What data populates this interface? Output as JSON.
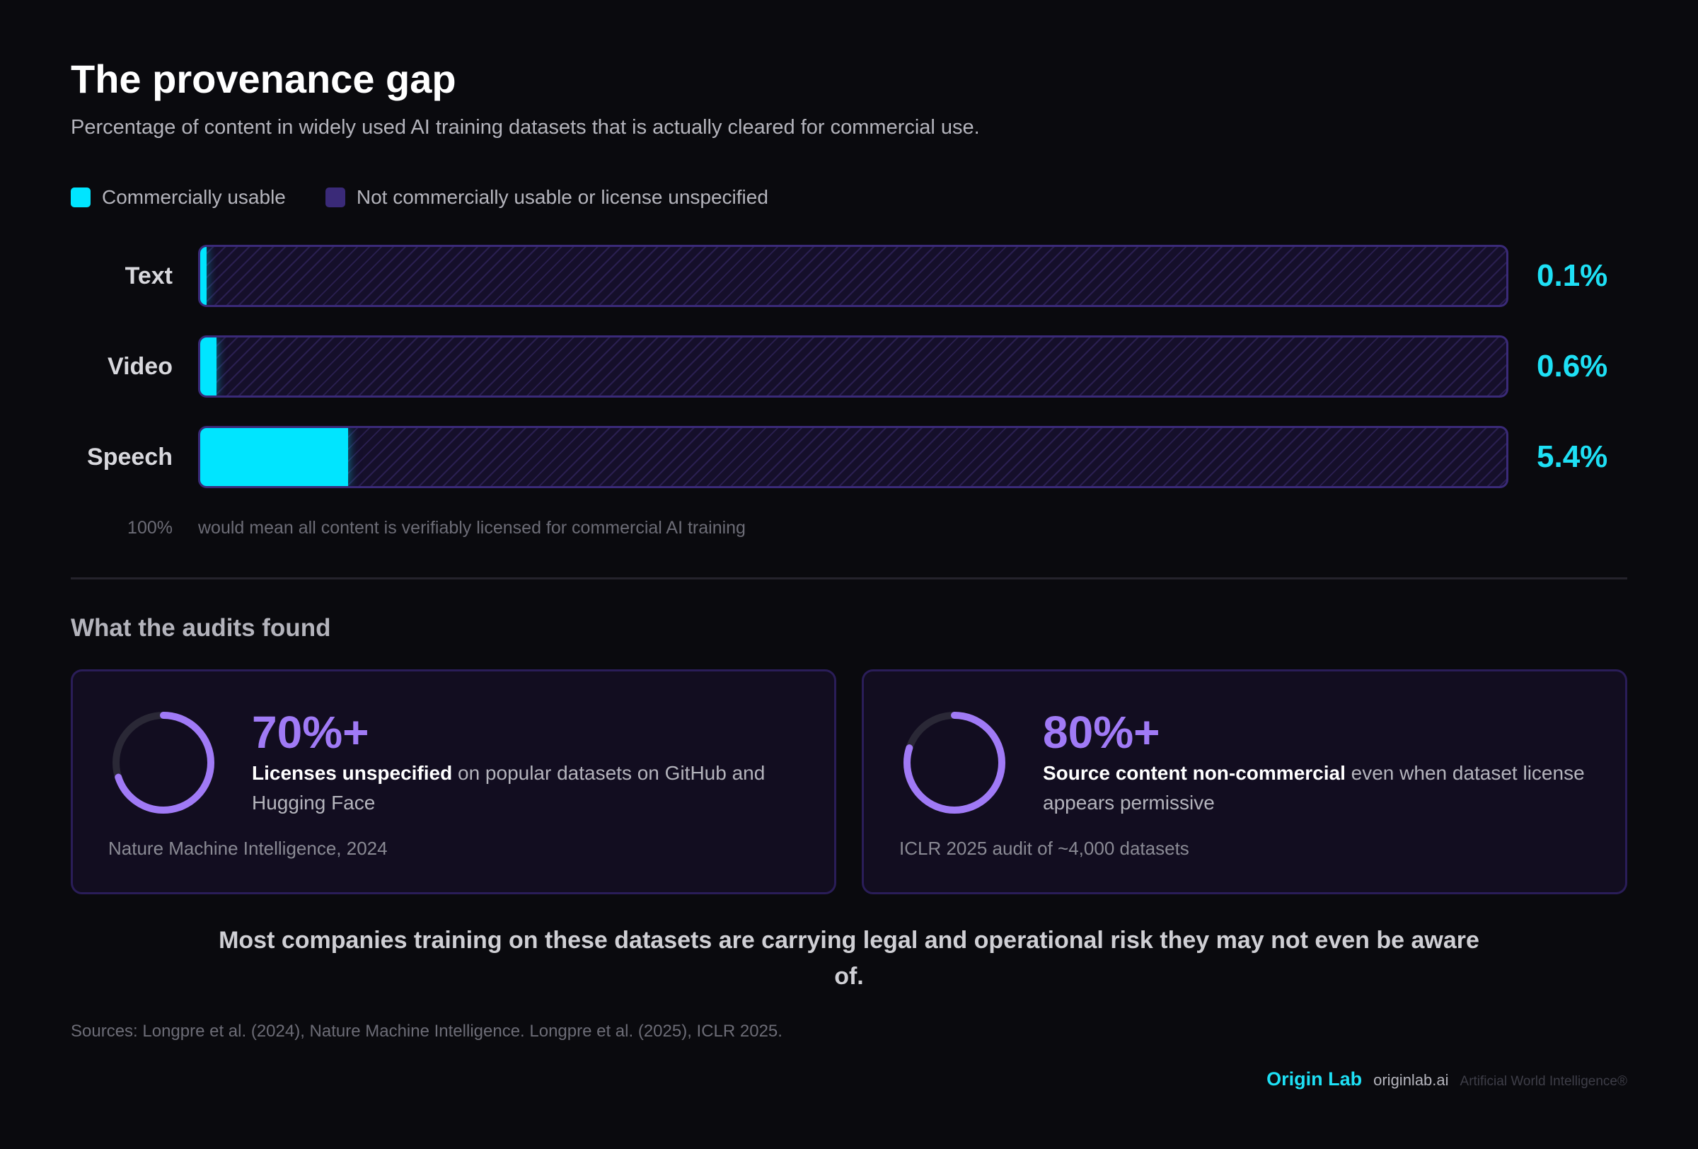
{
  "title": "The provenance gap",
  "subtitle": "Percentage of content in widely used AI training datasets that is actually cleared for commercial use.",
  "legend": [
    {
      "label": "Commercially usable",
      "color": "#00e5ff"
    },
    {
      "label": "Not commercially usable or license unspecified",
      "color": "#3a2a78"
    }
  ],
  "chart_data": {
    "type": "bar",
    "orientation": "horizontal",
    "stacked": true,
    "categories": [
      "Text",
      "Video",
      "Speech"
    ],
    "series": [
      {
        "name": "Commercially usable",
        "values": [
          0.1,
          0.6,
          5.4
        ]
      },
      {
        "name": "Not commercially usable or license unspecified",
        "values": [
          99.9,
          99.4,
          94.6
        ]
      }
    ],
    "value_labels": [
      "0.1%",
      "0.6%",
      "5.4%"
    ],
    "xlim": [
      0,
      100
    ],
    "legend_position": "top-left",
    "grid": false
  },
  "axis_note": {
    "pct": "100%",
    "text": "would mean all content is verifiably licensed for commercial AI training"
  },
  "section_title": "What the audits found",
  "cards": [
    {
      "stat": "70%+",
      "percent": 70,
      "highlight": "Licenses unspecified",
      "rest": " on popular datasets on GitHub and Hugging Face",
      "source": "Nature Machine Intelligence, 2024"
    },
    {
      "stat": "80%+",
      "percent": 80,
      "highlight": "Source content non-commercial",
      "rest": " even when dataset license appears permissive",
      "source": "ICLR 2025 audit of ~4,000 datasets"
    }
  ],
  "conclusion": "Most companies training on these datasets are carrying legal and operational risk they may not even be aware of.",
  "sources": "Sources: Longpre et al. (2024), Nature Machine Intelligence. Longpre et al. (2025), ICLR 2025.",
  "footer": {
    "brand": "Origin Lab",
    "url": "originlab.ai",
    "tagline": "Artificial World Intelligence®"
  },
  "colors": {
    "accent": "#00e5ff",
    "purple": "#a07af6",
    "track_border": "#3a2a78"
  }
}
